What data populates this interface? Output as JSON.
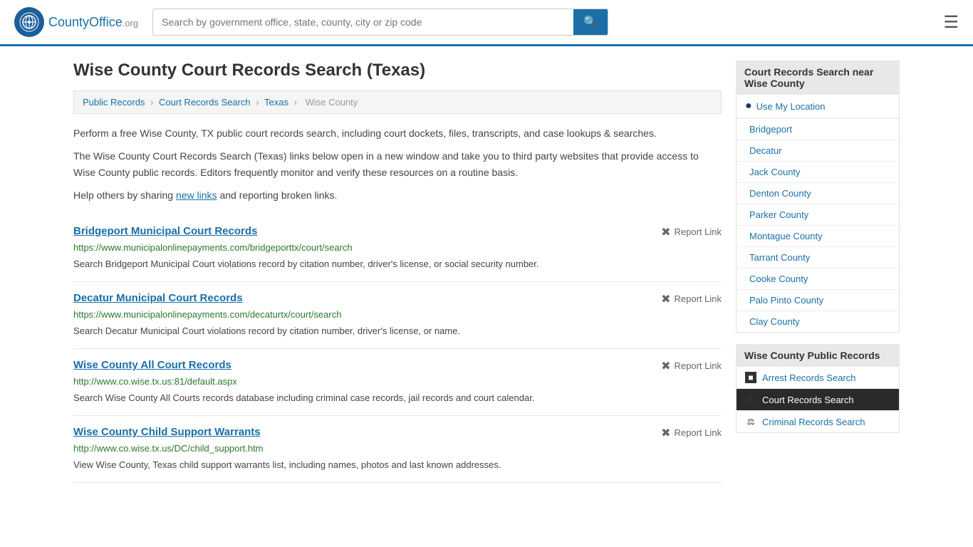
{
  "header": {
    "logo_text": "CountyOffice",
    "logo_org": ".org",
    "search_placeholder": "Search by government office, state, county, city or zip code",
    "search_value": ""
  },
  "page": {
    "title": "Wise County Court Records Search (Texas)",
    "description1": "Perform a free Wise County, TX public court records search, including court dockets, files, transcripts, and case lookups & searches.",
    "description2": "The Wise County Court Records Search (Texas) links below open in a new window and take you to third party websites that provide access to Wise County public records. Editors frequently monitor and verify these resources on a routine basis.",
    "description3": "Help others by sharing",
    "new_links_text": "new links",
    "description3b": "and reporting broken links."
  },
  "breadcrumb": {
    "items": [
      "Public Records",
      "Court Records Search",
      "Texas",
      "Wise County"
    ]
  },
  "records": [
    {
      "title": "Bridgeport Municipal Court Records",
      "url": "https://www.municipalonlinepayments.com/bridgeporttx/court/search",
      "description": "Search Bridgeport Municipal Court violations record by citation number, driver's license, or social security number.",
      "report_label": "Report Link"
    },
    {
      "title": "Decatur Municipal Court Records",
      "url": "https://www.municipalonlinepayments.com/decaturtx/court/search",
      "description": "Search Decatur Municipal Court violations record by citation number, driver's license, or name.",
      "report_label": "Report Link"
    },
    {
      "title": "Wise County All Court Records",
      "url": "http://www.co.wise.tx.us:81/default.aspx",
      "description": "Search Wise County All Courts records database including criminal case records, jail records and court calendar.",
      "report_label": "Report Link"
    },
    {
      "title": "Wise County Child Support Warrants",
      "url": "http://www.co.wise.tx.us/DC/child_support.htm",
      "description": "View Wise County, Texas child support warrants list, including names, photos and last known addresses.",
      "report_label": "Report Link"
    }
  ],
  "sidebar": {
    "nearby_title": "Court Records Search near Wise County",
    "use_location_label": "Use My Location",
    "nearby_items": [
      "Bridgeport",
      "Decatur",
      "Jack County",
      "Denton County",
      "Parker County",
      "Montague County",
      "Tarrant County",
      "Cooke County",
      "Palo Pinto County",
      "Clay County"
    ],
    "public_records_title": "Wise County Public Records",
    "public_records_items": [
      {
        "label": "Arrest Records Search",
        "active": false,
        "icon": "■"
      },
      {
        "label": "Court Records Search",
        "active": true,
        "icon": "🏛"
      },
      {
        "label": "Criminal Records Search",
        "active": false,
        "icon": "⚖"
      }
    ]
  }
}
